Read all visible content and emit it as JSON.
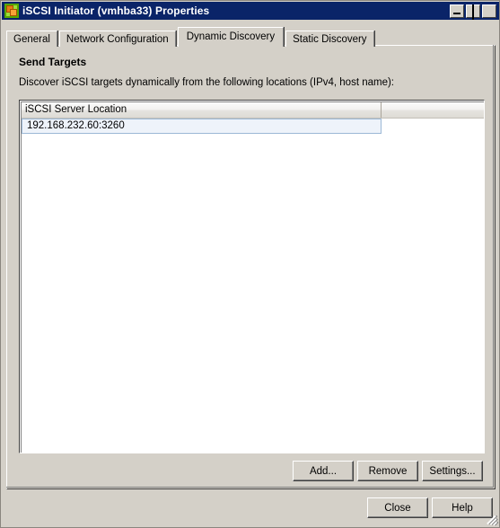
{
  "window": {
    "title": "iSCSI Initiator (vmhba33) Properties",
    "icon": "iscsi-adapter-icon",
    "controls": {
      "minimize": "Minimize",
      "maximize": "Maximize",
      "close": "Close"
    },
    "titlebar_color": "#0a2468",
    "face_color": "#d4d0c8"
  },
  "tabs": [
    {
      "label": "General",
      "active": false
    },
    {
      "label": "Network Configuration",
      "active": false
    },
    {
      "label": "Dynamic Discovery",
      "active": true
    },
    {
      "label": "Static Discovery",
      "active": false
    }
  ],
  "panel": {
    "section_title": "Send Targets",
    "section_desc": "Discover iSCSI targets dynamically from the following locations (IPv4, host name):"
  },
  "list": {
    "columns": [
      "iSCSI Server Location",
      ""
    ],
    "rows": [
      {
        "location": "192.168.232.60:3260",
        "selected": true
      }
    ],
    "selection_color": "#eef3fa",
    "selection_border": "#9cb8d6"
  },
  "actions": {
    "add": "Add...",
    "remove": "Remove",
    "settings": "Settings..."
  },
  "footer": {
    "close": "Close",
    "help": "Help",
    "grip": "resize-grip"
  }
}
